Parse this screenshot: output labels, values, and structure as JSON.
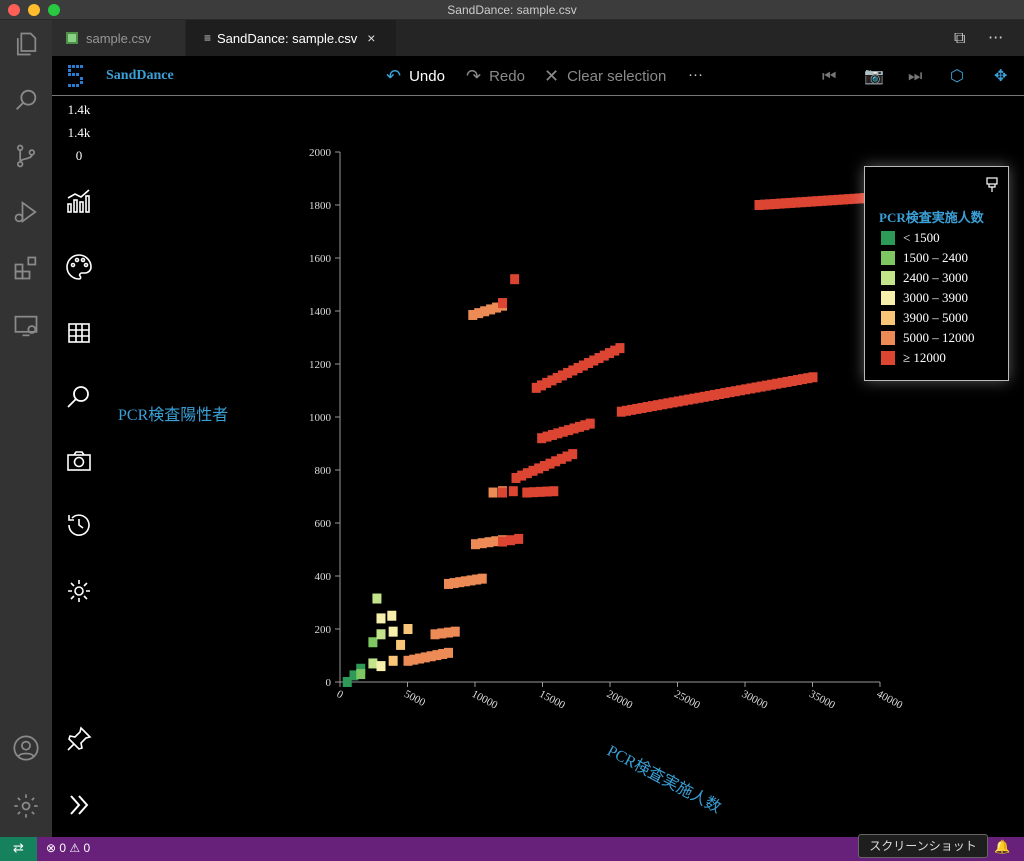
{
  "window": {
    "title": "SandDance: sample.csv"
  },
  "tabs": [
    {
      "label": "sample.csv",
      "icon": "csv-file-icon"
    },
    {
      "label": "SandDance: sample.csv",
      "icon": "preview-icon",
      "close": "×"
    }
  ],
  "tab_actions": {
    "split": "⧉",
    "more": "···"
  },
  "sanddance": {
    "brand": "SandDance",
    "undo": "Undo",
    "redo": "Redo",
    "clear": "Clear selection",
    "more": "···",
    "counts": [
      "1.4k",
      "1.4k",
      "0"
    ]
  },
  "colors": {
    "accent": "#3aa0d6",
    "status_bar": "#68217a",
    "remote": "#16825d"
  },
  "status": {
    "remote_icon": "⇄",
    "problems": "⊗ 0 ⚠ 0",
    "bell": "🔔",
    "tooltip": "スクリーンショット"
  },
  "chart_data": {
    "type": "scatter",
    "xlabel": "PCR検査実施人数",
    "ylabel": "PCR検査陽性者",
    "xlim": [
      0,
      40000
    ],
    "ylim": [
      0,
      2000
    ],
    "xticks": [
      0,
      5000,
      10000,
      15000,
      20000,
      25000,
      30000,
      35000,
      40000
    ],
    "yticks": [
      0,
      200,
      400,
      600,
      800,
      1000,
      1200,
      1400,
      1600,
      1800,
      2000
    ],
    "legend": {
      "title": "PCR検査実施人数",
      "placement": "top-right",
      "items": [
        {
          "label": "< 1500",
          "color": "#2e9a57"
        },
        {
          "label": "1500 – 2400",
          "color": "#7dc662"
        },
        {
          "label": "2400 – 3000",
          "color": "#c3e48b"
        },
        {
          "label": "3000 – 3900",
          "color": "#f6f0ac"
        },
        {
          "label": "3900 – 5000",
          "color": "#f9c679"
        },
        {
          "label": "5000 – 12000",
          "color": "#ed8b56"
        },
        {
          "label": "≥ 12000",
          "color": "#dd4533"
        }
      ]
    },
    "segments": [
      {
        "bin": 0,
        "x": [
          500,
          1500
        ],
        "y": [
          0,
          50
        ]
      },
      {
        "bin": 1,
        "x": [
          1500,
          2400
        ],
        "y": [
          30,
          150
        ]
      },
      {
        "bin": 2,
        "x": [
          2400,
          3000
        ],
        "y": [
          70,
          180
        ]
      },
      {
        "bin": 2,
        "x": [
          2500,
          2900
        ],
        "y": [
          310,
          320
        ]
      },
      {
        "bin": 3,
        "x": [
          3000,
          3900
        ],
        "y": [
          60,
          190
        ]
      },
      {
        "bin": 3,
        "x": [
          3000,
          3800
        ],
        "y": [
          240,
          250
        ]
      },
      {
        "bin": 4,
        "x": [
          3900,
          5000
        ],
        "y": [
          80,
          200
        ]
      },
      {
        "bin": 5,
        "x": [
          5000,
          8000
        ],
        "y": [
          80,
          110
        ]
      },
      {
        "bin": 5,
        "x": [
          7000,
          8500
        ],
        "y": [
          180,
          190
        ]
      },
      {
        "bin": 5,
        "x": [
          8000,
          10500
        ],
        "y": [
          370,
          390
        ]
      },
      {
        "bin": 5,
        "x": [
          10000,
          12000
        ],
        "y": [
          520,
          535
        ]
      },
      {
        "bin": 6,
        "x": [
          12000,
          13200
        ],
        "y": [
          530,
          540
        ]
      },
      {
        "bin": 5,
        "x": [
          11300,
          12000
        ],
        "y": [
          715,
          720
        ]
      },
      {
        "bin": 6,
        "x": [
          12000,
          12800
        ],
        "y": [
          715,
          720
        ]
      },
      {
        "bin": 6,
        "x": [
          13800,
          15800
        ],
        "y": [
          715,
          720
        ]
      },
      {
        "bin": 6,
        "x": [
          13000,
          17200
        ],
        "y": [
          770,
          860
        ]
      },
      {
        "bin": 6,
        "x": [
          14900,
          18500
        ],
        "y": [
          920,
          975
        ]
      },
      {
        "bin": 6,
        "x": [
          14500,
          20700
        ],
        "y": [
          1110,
          1260
        ]
      },
      {
        "bin": 5,
        "x": [
          9800,
          12000
        ],
        "y": [
          1385,
          1420
        ]
      },
      {
        "bin": 6,
        "x": [
          12000,
          12900
        ],
        "y": [
          1430,
          1520
        ]
      },
      {
        "bin": 6,
        "x": [
          20800,
          35000
        ],
        "y": [
          1020,
          1150
        ]
      },
      {
        "bin": 6,
        "x": [
          31000,
          40000
        ],
        "y": [
          1800,
          1830
        ]
      }
    ]
  }
}
